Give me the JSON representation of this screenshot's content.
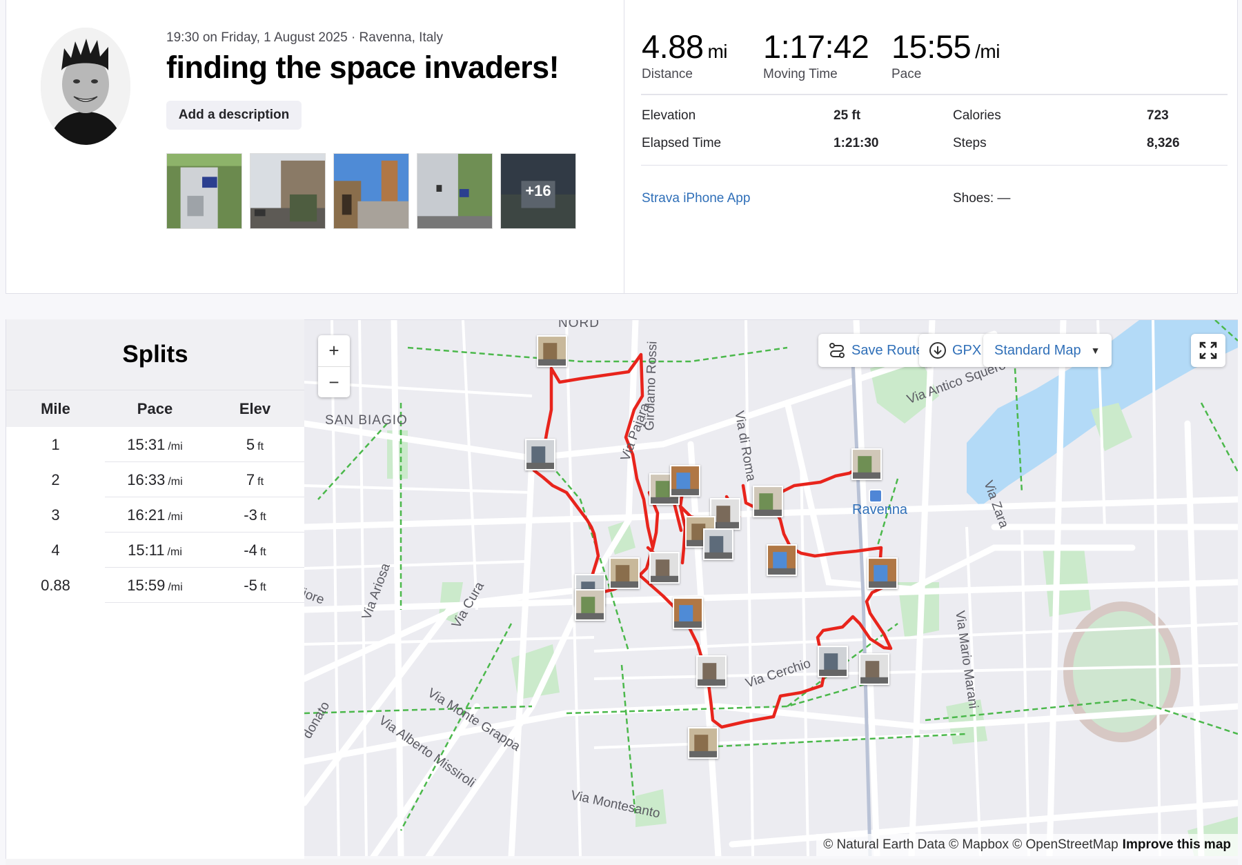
{
  "activity": {
    "meta": "19:30 on Friday, 1 August 2025 · Ravenna, Italy",
    "title": "finding the space invaders!",
    "add_description_label": "Add a description",
    "photos": [
      {
        "icon": "photo-thumbnail-building-icon"
      },
      {
        "icon": "photo-thumbnail-street-icon"
      },
      {
        "icon": "photo-thumbnail-tower-icon"
      },
      {
        "icon": "photo-thumbnail-wall-icon"
      },
      {
        "icon": "photo-thumbnail-more-icon",
        "more_label": "+16"
      }
    ]
  },
  "stats": {
    "distance": {
      "value": "4.88",
      "unit": "mi",
      "label": "Distance"
    },
    "moving_time": {
      "value": "1:17:42",
      "label": "Moving Time"
    },
    "pace": {
      "value": "15:55",
      "unit": "/mi",
      "label": "Pace"
    },
    "elevation_label": "Elevation",
    "elevation_value": "25 ft",
    "calories_label": "Calories",
    "calories_value": "723",
    "elapsed_label": "Elapsed Time",
    "elapsed_value": "1:21:30",
    "steps_label": "Steps",
    "steps_value": "8,326",
    "device_link": "Strava iPhone App",
    "shoes": "Shoes: —"
  },
  "splits": {
    "title": "Splits",
    "columns": [
      "Mile",
      "Pace",
      "Elev"
    ],
    "rows": [
      {
        "mile": "1",
        "pace": "15:31",
        "pace_unit": "/mi",
        "elev": "5",
        "elev_unit": "ft"
      },
      {
        "mile": "2",
        "pace": "16:33",
        "pace_unit": "/mi",
        "elev": "7",
        "elev_unit": "ft"
      },
      {
        "mile": "3",
        "pace": "16:21",
        "pace_unit": "/mi",
        "elev": "-3",
        "elev_unit": "ft"
      },
      {
        "mile": "4",
        "pace": "15:11",
        "pace_unit": "/mi",
        "elev": "-4",
        "elev_unit": "ft"
      },
      {
        "mile": "0.88",
        "pace": "15:59",
        "pace_unit": "/mi",
        "elev": "-5",
        "elev_unit": "ft"
      }
    ]
  },
  "map": {
    "zoom_in": "+",
    "zoom_out": "−",
    "save_route": "Save Route",
    "gpx": "GPX",
    "map_style": "Standard Map",
    "labels": {
      "nord": "NORD",
      "san_biagio": "SAN BIAGIO",
      "via_antico_squero": "Via Antico Squero",
      "girolamo_rossi": "Girolamo Rossi",
      "via_di_roma": "Via di Roma",
      "via_zara": "Via Zara",
      "ravenna": "Ravenna",
      "via_ariosa": "Via Ariosa",
      "via_cura": "Via Cura",
      "via_cerchio": "Via Cerchio",
      "via_mario_marani": "Via Mario Marani",
      "via_monte_grappa": "Via Monte Grappa",
      "via_alberto_missiroli": "Via Alberto Missiroli",
      "via_montesanto": "Via Montesanto",
      "donato": "donato",
      "fiore": "fiore",
      "via_pajara": "Via Pajara"
    },
    "attribution": "© Natural Earth Data © Mapbox © OpenStreetMap",
    "improve": "Improve this map",
    "route_color": "#e8241c",
    "water_color": "#b3daf7",
    "park_color": "#cbeacb"
  }
}
